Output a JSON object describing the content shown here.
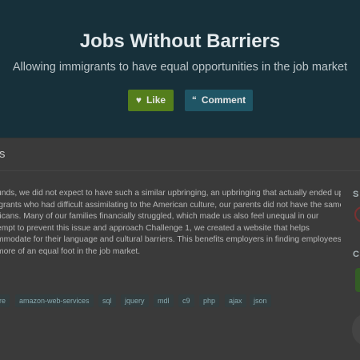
{
  "hero": {
    "title": "Jobs Without Barriers",
    "subtitle": "Allowing immigrants to have equal opportunities in the job market",
    "like_label": "Like",
    "comment_label": "Comment"
  },
  "section": {
    "heading_fragment": "s"
  },
  "description": {
    "lines": [
      "unds, we did not expect to have such a similar upbringing, an upbringing that actually ended up",
      "igrants who had difficult assimilating to the American culture, our parents did not have the same",
      "ricans. Many of our families financially struggled, which made us also feel unequal in our",
      "empt to prevent this issue and approach Challenge 1, we created a website that helps",
      "mmodate for their language and cultural barriers. This benefits employers in finding employees,",
      "more of an equal foot in the job market."
    ]
  },
  "tags": [
    "re",
    "amazon-web-services",
    "sql",
    "jquery",
    "mdl",
    "c9",
    "php",
    "ajax",
    "json"
  ],
  "sidebar": {
    "heading_1_fragment": "S",
    "heading_2_fragment": "C"
  },
  "icons": {
    "like": "heart-icon",
    "comment": "quote-icon"
  },
  "colors": {
    "hero_bg": "#17303a",
    "like_button": "#547e1c",
    "comment_button": "#1f5565",
    "tag_bg": "#333d3f",
    "tag_text": "#8aaab0"
  }
}
